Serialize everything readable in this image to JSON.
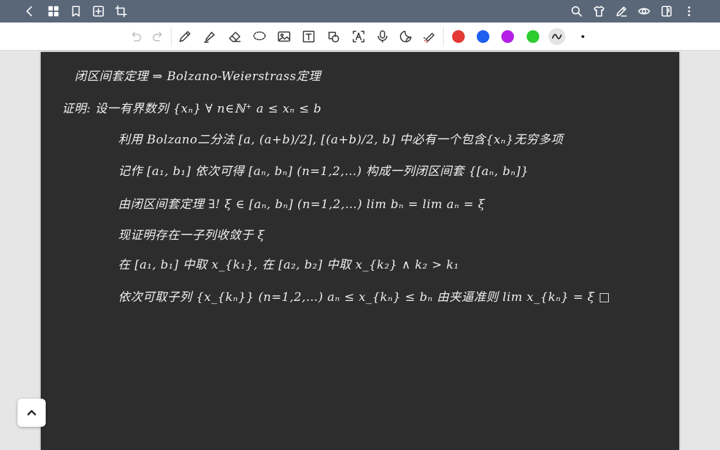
{
  "toolbar": {
    "colors": {
      "red": "#e53935",
      "blue": "#1e5ff0",
      "purple": "#b41ee6",
      "green": "#2ecc2e"
    }
  },
  "notes": {
    "line1": "闭区间套定理 ⇒ Bolzano-Weierstrass定理",
    "line2": "证明: 设一有界数列 {xₙ}   ∀ n∈ℕ⁺    a ≤ xₙ ≤ b",
    "line3": "利用 Bolzano二分法   [a, (a+b)/2], [(a+b)/2, b] 中必有一个包含{xₙ}无穷多项",
    "line4": "记作 [a₁, b₁]  依次可得 [aₙ, bₙ] (n=1,2,…)   构成一列闭区间套 {[aₙ, bₙ]}",
    "line5": "由闭区间套定理 ∃! ξ ∈ [aₙ, bₙ] (n=1,2,…)   lim bₙ = lim aₙ = ξ",
    "line6": "现证明存在一子列收敛于 ξ",
    "line7": "在 [a₁, b₁] 中取 x_{k₁}, 在 [a₂, b₂] 中取 x_{k₂}  ∧ k₂ > k₁",
    "line8": "依次可取子列 {x_{kₙ}} (n=1,2,…)    aₙ ≤ x_{kₙ} ≤ bₙ   由夹逼准则  lim x_{kₙ} = ξ   □"
  }
}
